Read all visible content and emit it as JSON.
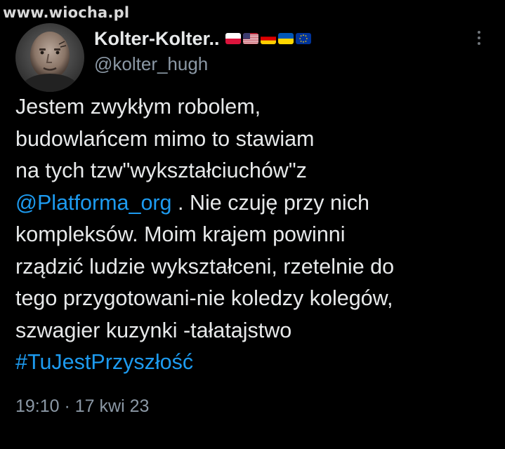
{
  "watermark": "www.wiocha.pl",
  "profile": {
    "display_name": "Kolter-Kolter..",
    "handle": "@kolter_hugh",
    "flags": [
      "flag-poland-icon",
      "flag-usa-icon",
      "flag-germany-icon",
      "flag-ukraine-icon",
      "flag-eu-icon"
    ]
  },
  "tweet": {
    "line1": "Jestem zwykłym robolem,",
    "line2": "budowlańcem mimo to stawiam",
    "line3": "na tych tzw\"wykształciuchów\"z",
    "mention": "@Platforma_org",
    "line4_rest": " . Nie czuję przy nich",
    "line5": "kompleksów. Moim krajem powinni",
    "line6": "rządzić ludzie wykształceni, rzetelnie do",
    "line7": "tego przygotowani-nie koledzy kolegów,",
    "line8": "szwagier kuzynki -tałatajstwo",
    "hashtag": "#TuJestPrzyszłość"
  },
  "meta": {
    "time": "19:10",
    "separator": " · ",
    "date": "17 kwi 23"
  },
  "colors": {
    "background": "#000000",
    "text": "#e7e9ea",
    "secondary": "#8b98a5",
    "link": "#1d9bf0"
  }
}
